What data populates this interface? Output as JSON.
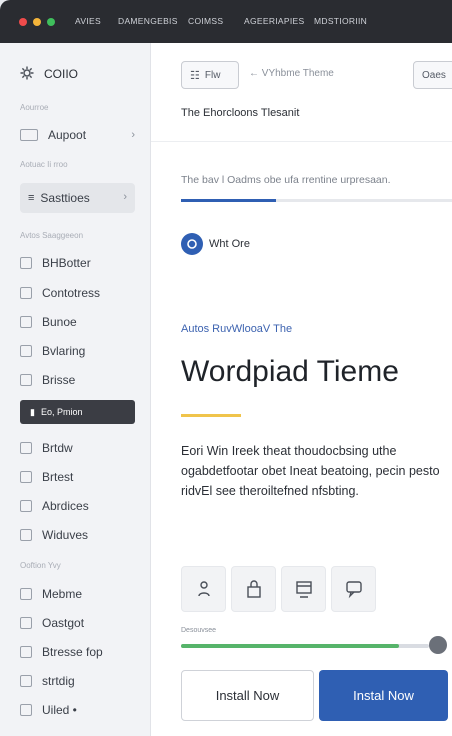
{
  "titlebar": {
    "colors": {
      "red": "#ef4b4b",
      "yellow": "#f3b43a",
      "green": "#3fbf5c"
    },
    "nav": [
      "AVIES",
      "DAMENGEBIS",
      "COIMSS",
      "AGEERIAPIES",
      "MDSTIORIIN"
    ]
  },
  "sidebar": {
    "brand": {
      "label": "COIIO",
      "icon": "gear-icon"
    },
    "section1": "Aourroe",
    "item_aupoot": "Aupoot",
    "section2": "Aotuac Ii rroo",
    "item_sasttioes": "Sasttioes",
    "section3": "Avtos Saaggeeon",
    "group1": [
      {
        "label": "BHBotter",
        "icon": "square-icon"
      },
      {
        "label": "Contotress",
        "icon": "list-icon"
      },
      {
        "label": "Bunoe",
        "icon": "image-icon"
      },
      {
        "label": "Bvlaring",
        "icon": "chart-icon"
      },
      {
        "label": "Brisse",
        "icon": "grid-icon"
      }
    ],
    "active_item": "Eo, Pmion",
    "group2": [
      {
        "label": "Brtdw",
        "icon": "list-icon"
      },
      {
        "label": "Brtest",
        "icon": "doc-icon"
      },
      {
        "label": "Abrdices",
        "icon": "image-icon"
      },
      {
        "label": "Widuves",
        "icon": "chart-icon"
      }
    ],
    "section4": "Ooftion Yvy",
    "group3": [
      {
        "label": "Mebme",
        "icon": "square-icon"
      },
      {
        "label": "Oastgot",
        "icon": "doc-icon"
      },
      {
        "label": "Btresse fop",
        "icon": "list-icon"
      },
      {
        "label": "strtdig",
        "icon": "grid-icon"
      },
      {
        "label": "Uiled •",
        "icon": "doc-icon"
      }
    ]
  },
  "toolbar": {
    "left_button": "Flw",
    "breadcrumb": "← VYhbme Theme",
    "right_button": "Oaes"
  },
  "main": {
    "subtitle": "The Ehorcloons Tlesanit",
    "description": "The bav l Oadms obe ufa rrentine urpresaan.",
    "description_progress": 0.35,
    "author": "Wht Ore",
    "eyebrow": "Autos RuvWlooaV The",
    "title": "Wordpiad Tieme",
    "body": "Eori Win Ireek theat thoudocbsing uthe ogabdetfootar obet Ineat beatoing, pecin pesto ridvEl see theroiltefned nfsbting.",
    "meter_label": "Desouvsee",
    "meter_value": 0.88,
    "install_outline": "Install Now",
    "install_primary": "Instal Now",
    "accent_blue": "#2f5fb3",
    "accent_yellow": "#f0c44b",
    "accent_green": "#56b46a"
  }
}
